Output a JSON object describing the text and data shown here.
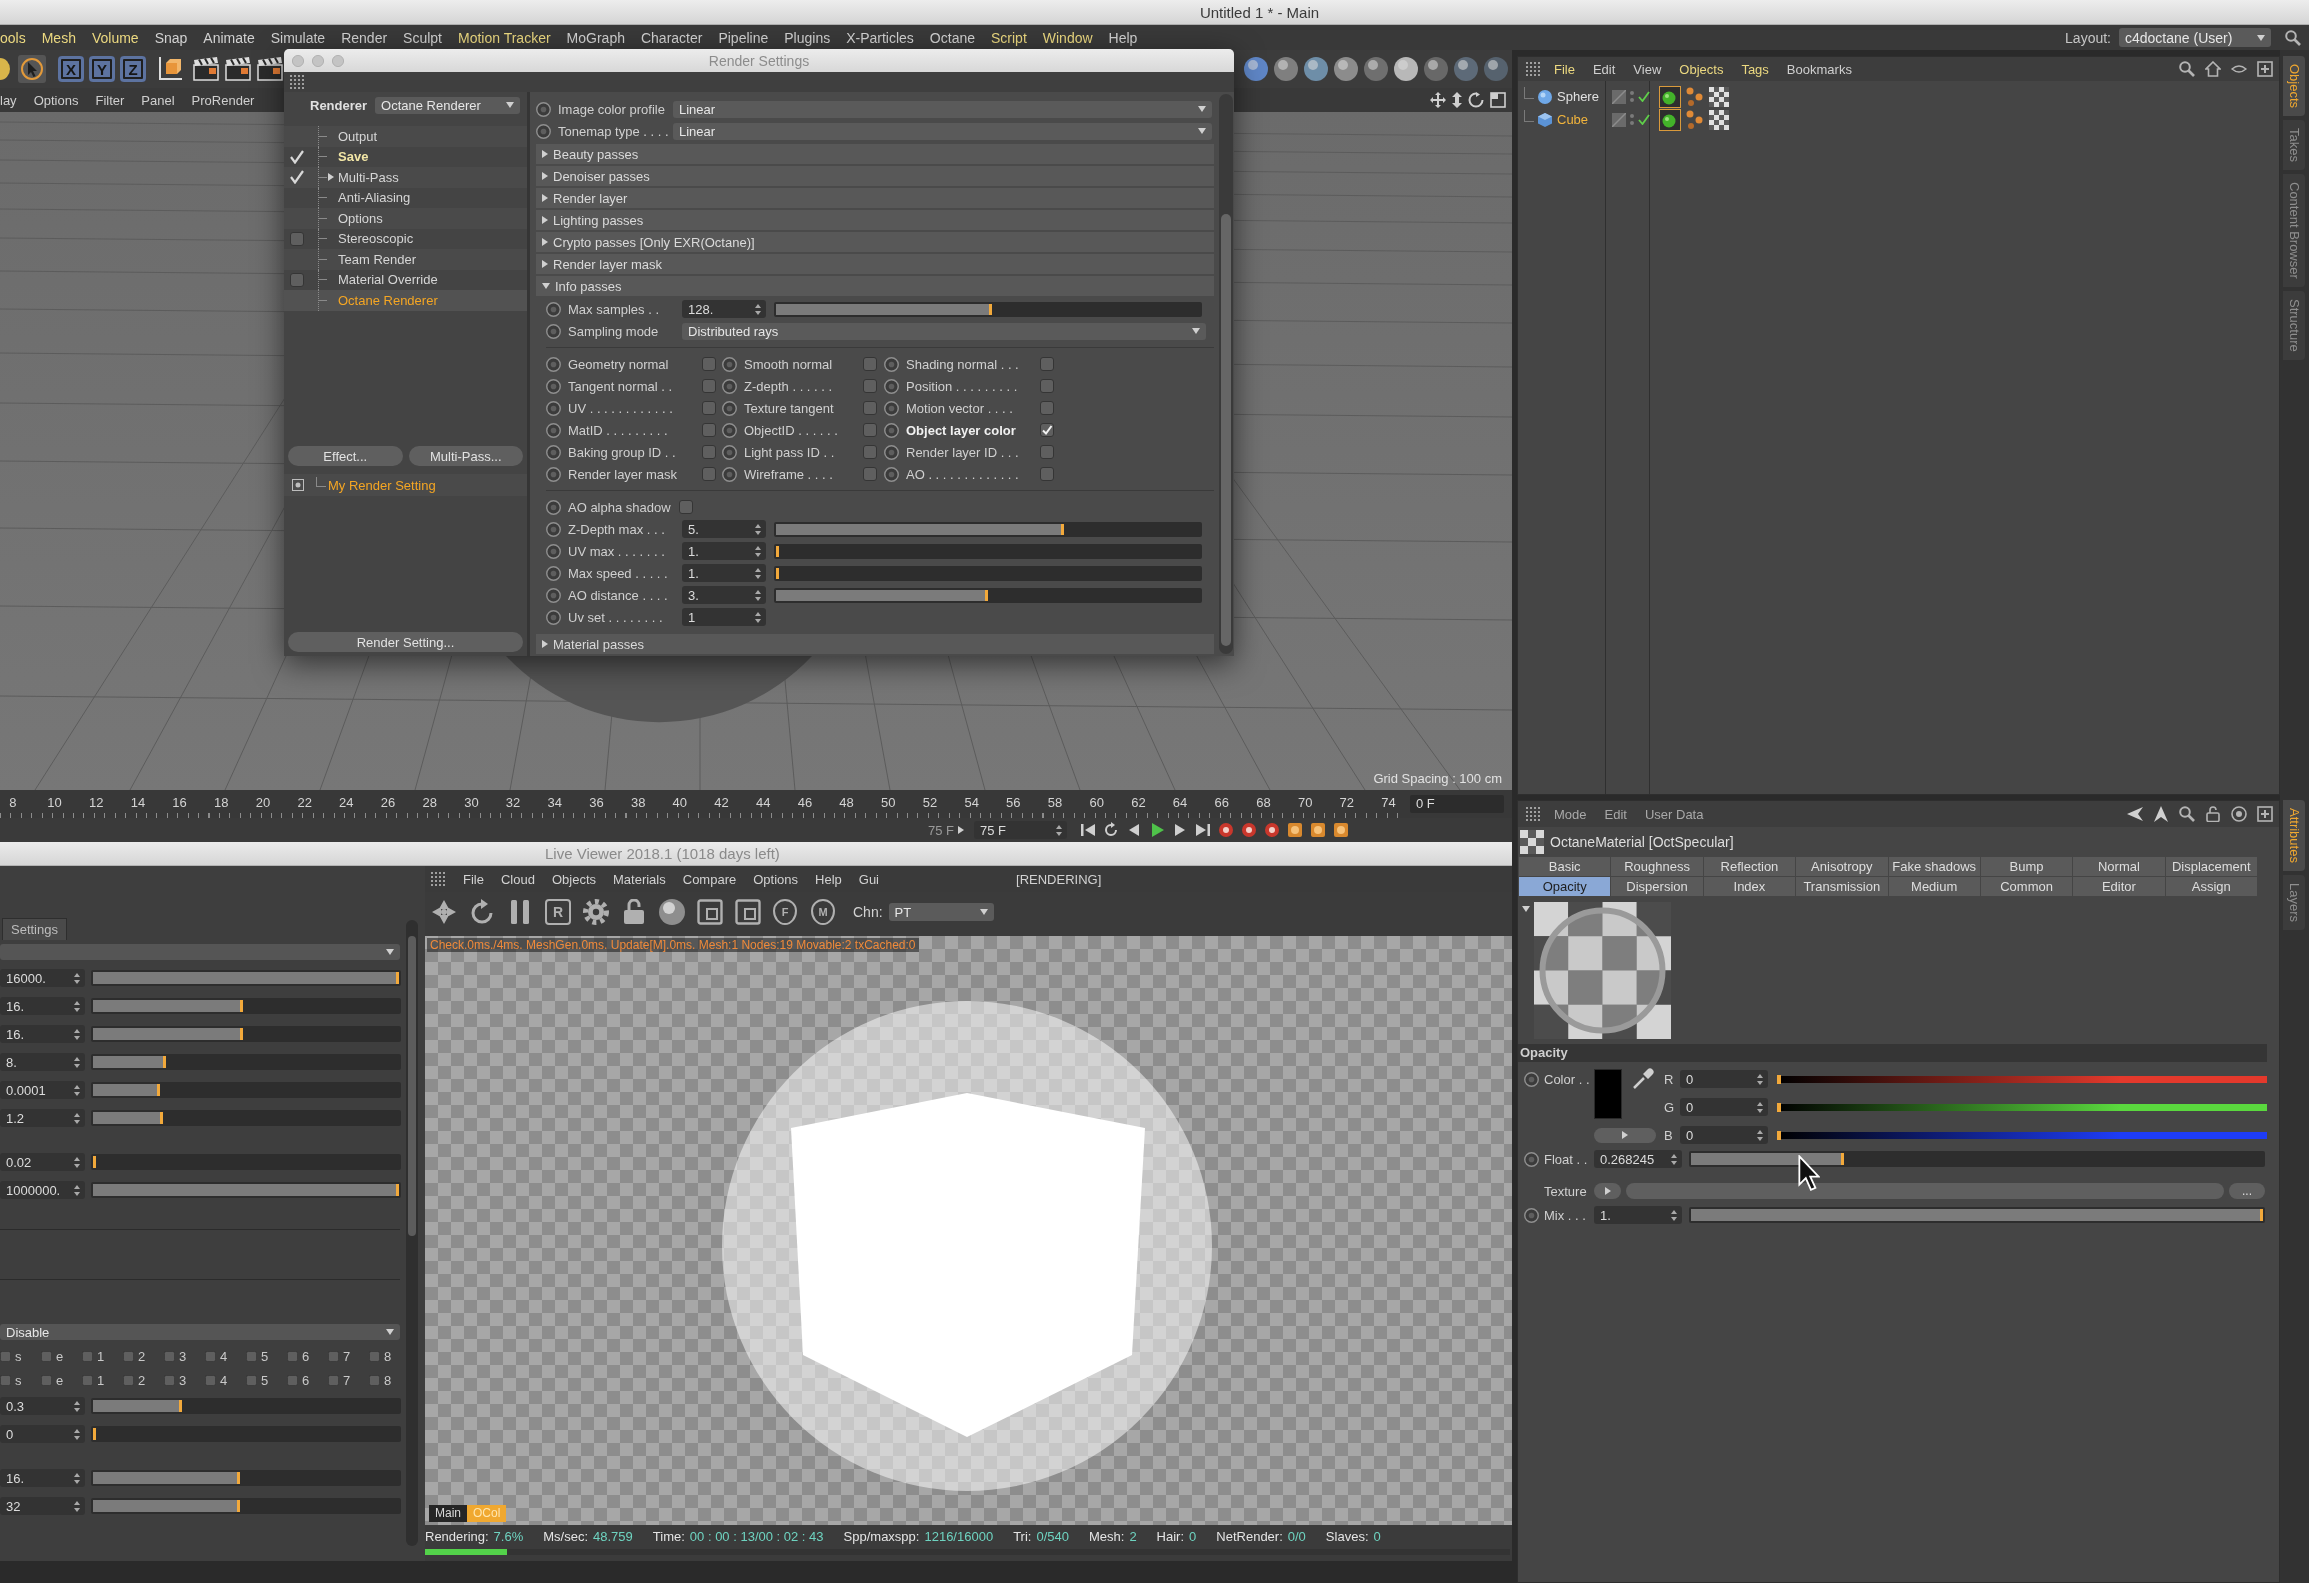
{
  "app": {
    "title": "Untitled 1 * - Main",
    "menu": [
      {
        "label": "ools",
        "highlighted": true
      },
      {
        "label": "Mesh",
        "highlighted": true
      },
      {
        "label": "Volume",
        "highlighted": true
      },
      {
        "label": "Snap",
        "highlighted": false
      },
      {
        "label": "Animate",
        "highlighted": false
      },
      {
        "label": "Simulate",
        "highlighted": false
      },
      {
        "label": "Render",
        "highlighted": false
      },
      {
        "label": "Sculpt",
        "highlighted": false
      },
      {
        "label": "Motion Tracker",
        "highlighted": true
      },
      {
        "label": "MoGraph",
        "highlighted": false
      },
      {
        "label": "Character",
        "highlighted": false
      },
      {
        "label": "Pipeline",
        "highlighted": false
      },
      {
        "label": "Plugins",
        "highlighted": false
      },
      {
        "label": "X-Particles",
        "highlighted": false
      },
      {
        "label": "Octane",
        "highlighted": false
      },
      {
        "label": "Script",
        "highlighted": true
      },
      {
        "label": "Window",
        "highlighted": true
      },
      {
        "label": "Help",
        "highlighted": false
      }
    ],
    "layout_label": "Layout:",
    "layout": "c4doctane (User)"
  },
  "toolbar": {
    "axis_buttons": [
      "X",
      "Y",
      "Z"
    ]
  },
  "viewport": {
    "menu": [
      "lay",
      "Options",
      "Filter",
      "Panel",
      "ProRender"
    ],
    "grid_spacing": "Grid Spacing : 100 cm"
  },
  "timeline": {
    "frames": [
      "8",
      "10",
      "12",
      "14",
      "16",
      "18",
      "20",
      "22",
      "24",
      "26",
      "28",
      "30",
      "32",
      "34",
      "36",
      "38",
      "40",
      "42",
      "44",
      "46",
      "48",
      "50",
      "52",
      "54",
      "56",
      "58",
      "60",
      "62",
      "64",
      "66",
      "68",
      "70",
      "72",
      "74"
    ],
    "current_frame": "0 F",
    "range_end": "75 F",
    "end_frame": "75 F"
  },
  "render_settings": {
    "title": "Render Settings",
    "renderer_label": "Renderer",
    "renderer": "Octane Renderer",
    "tree": [
      {
        "label": "Output",
        "selected": false,
        "highlighted": false
      },
      {
        "label": "Save",
        "selected": false,
        "highlighted": true,
        "checked": true
      },
      {
        "label": "Multi-Pass",
        "selected": false,
        "highlighted": false,
        "checked": true,
        "expanded": false
      },
      {
        "label": "Anti-Aliasing",
        "selected": false,
        "highlighted": false
      },
      {
        "label": "Options",
        "selected": false,
        "highlighted": false
      },
      {
        "label": "Stereoscopic",
        "selected": false,
        "highlighted": false,
        "checked": false
      },
      {
        "label": "Team Render",
        "selected": false,
        "highlighted": false
      },
      {
        "label": "Material Override",
        "selected": false,
        "highlighted": false,
        "checked": false
      },
      {
        "label": "Octane Renderer",
        "selected": true,
        "highlighted": false
      }
    ],
    "buttons": [
      "Effect...",
      "Multi-Pass..."
    ],
    "preset": "My Render Setting",
    "footer_button": "Render Setting...",
    "params": [
      {
        "label": "Image color profile",
        "value": "Linear"
      },
      {
        "label": "Tonemap type . . . .",
        "value": "Linear"
      }
    ],
    "sections": [
      {
        "label": "Beauty passes",
        "expanded": false
      },
      {
        "label": "Denoiser passes",
        "expanded": false
      },
      {
        "label": "Render layer",
        "expanded": false
      },
      {
        "label": "Lighting passes",
        "expanded": false
      },
      {
        "label": "Crypto passes [Only EXR(Octane)]",
        "expanded": false
      },
      {
        "label": "Render layer mask",
        "expanded": false
      },
      {
        "label": "Info passes",
        "expanded": true,
        "rows": [
          {
            "kind": "slider",
            "label": "Max samples . .",
            "value": "128.",
            "level": 0.51
          },
          {
            "kind": "dropdown",
            "label": "Sampling mode",
            "value": "Distributed rays"
          },
          {
            "kind": "passes",
            "items": [
              {
                "label": "Geometry normal",
                "checked": false
              },
              {
                "label": "Smooth normal",
                "checked": false
              },
              {
                "label": "Shading normal . . .",
                "checked": false
              },
              {
                "label": "Tangent normal . .",
                "checked": false
              },
              {
                "label": "Z-depth . . . . . .",
                "checked": false
              },
              {
                "label": "Position . . . . . . . . .",
                "checked": false
              },
              {
                "label": "UV . . . . . . . . . . . .",
                "checked": false
              },
              {
                "label": "Texture tangent",
                "checked": false
              },
              {
                "label": "Motion vector . . . .",
                "checked": false
              },
              {
                "label": "MatID . . . . . . . . .",
                "checked": false
              },
              {
                "label": "ObjectID . . . . . .",
                "checked": false
              },
              {
                "label": "Object layer color",
                "checked": true
              },
              {
                "label": "Baking group ID . .",
                "checked": false
              },
              {
                "label": "Light pass ID . .",
                "checked": false
              },
              {
                "label": "Render layer ID . . .",
                "checked": false
              },
              {
                "label": "Render layer mask",
                "checked": false
              },
              {
                "label": "Wireframe . . . .",
                "checked": false
              },
              {
                "label": "AO . . . . . . . . . . . . .",
                "checked": false
              }
            ]
          },
          {
            "kind": "checkbox",
            "label": "AO alpha shadow",
            "checked": false
          },
          {
            "kind": "slider",
            "label": "Z-Depth max . . .",
            "value": "5.",
            "level": 0.68
          },
          {
            "kind": "slider",
            "label": "UV max . . . . . . .",
            "value": "1.",
            "level": 0.005
          },
          {
            "kind": "slider",
            "label": "Max speed . . . . .",
            "value": "1.",
            "level": 0.005
          },
          {
            "kind": "slider",
            "label": "AO distance . . . .",
            "value": "3.",
            "level": 0.5
          },
          {
            "kind": "field",
            "label": "Uv set . . . . . . . .",
            "value": "1"
          }
        ]
      },
      {
        "label": "Material passes",
        "expanded": false
      }
    ]
  },
  "objects_panel": {
    "menu": [
      {
        "label": "File",
        "highlighted": true
      },
      {
        "label": "Edit",
        "highlighted": false
      },
      {
        "label": "View",
        "highlighted": false
      },
      {
        "label": "Objects",
        "highlighted": true
      },
      {
        "label": "Tags",
        "highlighted": true
      },
      {
        "label": "Bookmarks",
        "highlighted": false
      }
    ],
    "objects": [
      {
        "name": "Sphere",
        "kind": "sphere",
        "selected": false
      },
      {
        "name": "Cube",
        "kind": "cube",
        "selected": true
      }
    ]
  },
  "side_tabs": {
    "upper": [
      {
        "label": "Objects",
        "selected": true
      },
      {
        "label": "Takes",
        "selected": false
      },
      {
        "label": "Content Browser",
        "selected": false
      },
      {
        "label": "Structure",
        "selected": false
      }
    ],
    "lower": [
      {
        "label": "Attributes",
        "selected": true
      },
      {
        "label": "Layers",
        "selected": false
      }
    ]
  },
  "attributes": {
    "menu": [
      "Mode",
      "Edit",
      "User Data"
    ],
    "title": "OctaneMaterial [OctSpecular]",
    "tabs": [
      {
        "label": "Basic",
        "selected": false
      },
      {
        "label": "Roughness",
        "selected": false
      },
      {
        "label": "Reflection",
        "selected": false
      },
      {
        "label": "Anisotropy",
        "selected": false
      },
      {
        "label": "Fake shadows",
        "selected": false
      },
      {
        "label": "Bump",
        "selected": false
      },
      {
        "label": "Normal",
        "selected": false
      },
      {
        "label": "Displacement",
        "selected": false
      },
      {
        "label": "Opacity",
        "selected": true
      },
      {
        "label": "Dispersion",
        "selected": false
      },
      {
        "label": "Index",
        "selected": false
      },
      {
        "label": "Transmission",
        "selected": false
      },
      {
        "label": "Medium",
        "selected": false
      },
      {
        "label": "Common",
        "selected": false
      },
      {
        "label": "Editor",
        "selected": false
      },
      {
        "label": "Assign",
        "selected": false
      }
    ],
    "section": "Opacity",
    "color": {
      "label": "Color . .",
      "channels": [
        {
          "name": "R",
          "value": "0",
          "level": 0,
          "color": "#e4392c"
        },
        {
          "name": "G",
          "value": "0",
          "level": 0,
          "color": "#5ad83e"
        },
        {
          "name": "B",
          "value": "0",
          "level": 0,
          "color": "#1e3cf6"
        }
      ]
    },
    "float": {
      "label": "Float . .",
      "value": "0.268245",
      "level": 0.268
    },
    "texture": {
      "label": "Texture",
      "browse": "..."
    },
    "mix": {
      "label": "Mix . . .",
      "value": "1.",
      "level": 1
    }
  },
  "live_viewer": {
    "title": "Live Viewer 2018.1 (1018 days left)",
    "menu": [
      "File",
      "Cloud",
      "Objects",
      "Materials",
      "Compare",
      "Options",
      "Help",
      "Gui"
    ],
    "render_state": "[RENDERING]",
    "render_button": "R",
    "pins": [
      "F",
      "M"
    ],
    "channel_label": "Chn:",
    "channel": "PT",
    "settings_tab": "Settings",
    "settings": [
      {
        "kind": "dropdown"
      },
      {
        "kind": "slider",
        "value": "16000.",
        "level": 1
      },
      {
        "kind": "slider",
        "value": "16.",
        "level": 0.49
      },
      {
        "kind": "slider",
        "value": "16.",
        "level": 0.49
      },
      {
        "kind": "slider",
        "value": "8.",
        "level": 0.24
      },
      {
        "kind": "slider",
        "value": "0.0001",
        "level": 0.22
      },
      {
        "kind": "slider",
        "value": "1.2",
        "level": 0.23
      },
      {
        "kind": "gap"
      },
      {
        "kind": "slider",
        "value": "0.02",
        "level": 0.01
      },
      {
        "kind": "slider",
        "value": "1000000.",
        "level": 1
      },
      {
        "kind": "separator"
      },
      {
        "kind": "separator"
      },
      {
        "kind": "gap"
      },
      {
        "kind": "dropdown",
        "value": "Disable"
      },
      {
        "kind": "checks",
        "items": [
          {
            "label": "s",
            "checked": false
          },
          {
            "label": "e",
            "checked": false
          },
          {
            "label": "1",
            "checked": false
          },
          {
            "label": "2",
            "checked": false
          },
          {
            "label": "3",
            "checked": false
          },
          {
            "label": "4",
            "checked": false
          },
          {
            "label": "5",
            "checked": false
          },
          {
            "label": "6",
            "checked": false
          },
          {
            "label": "7",
            "checked": false
          },
          {
            "label": "8",
            "checked": false
          }
        ]
      },
      {
        "kind": "checks",
        "items": [
          {
            "label": "s",
            "checked": false
          },
          {
            "label": "e",
            "checked": false
          },
          {
            "label": "1",
            "checked": false
          },
          {
            "label": "2",
            "checked": false
          },
          {
            "label": "3",
            "checked": false
          },
          {
            "label": "4",
            "checked": false
          },
          {
            "label": "5",
            "checked": false
          },
          {
            "label": "6",
            "checked": false
          },
          {
            "label": "7",
            "checked": false
          },
          {
            "label": "8",
            "checked": false
          }
        ]
      },
      {
        "kind": "slider",
        "value": "0.3",
        "level": 0.29
      },
      {
        "kind": "slider",
        "value": "0",
        "level": 0
      },
      {
        "kind": "gap"
      },
      {
        "kind": "slider",
        "value": "16.",
        "level": 0.48
      },
      {
        "kind": "slider",
        "value": "32",
        "level": 0.48
      }
    ],
    "overlay": "Check.0ms./4ms. MeshGen.0ms. Update[M].0ms. Mesh:1 Nodes:19 Movable:2 txCached:0",
    "view_tabs": [
      {
        "label": "Main",
        "selected": false
      },
      {
        "label": "OCol",
        "selected": true
      }
    ],
    "status": [
      {
        "label": "Rendering:",
        "value": "7.6%"
      },
      {
        "label": "Ms/sec:",
        "value": "48.759"
      },
      {
        "label": "Time:",
        "value": "00 : 00 : 13/00 : 02 : 43"
      },
      {
        "label": "Spp/maxspp:",
        "value": "1216/16000"
      },
      {
        "label": "Tri:",
        "value": "0/540"
      },
      {
        "label": "Mesh:",
        "value": "2"
      },
      {
        "label": "Hair:",
        "value": "0"
      },
      {
        "label": "NetRender:",
        "value": "0/0"
      },
      {
        "label": "Slaves:",
        "value": "0"
      }
    ],
    "progress": {
      "level": 0.076
    }
  }
}
